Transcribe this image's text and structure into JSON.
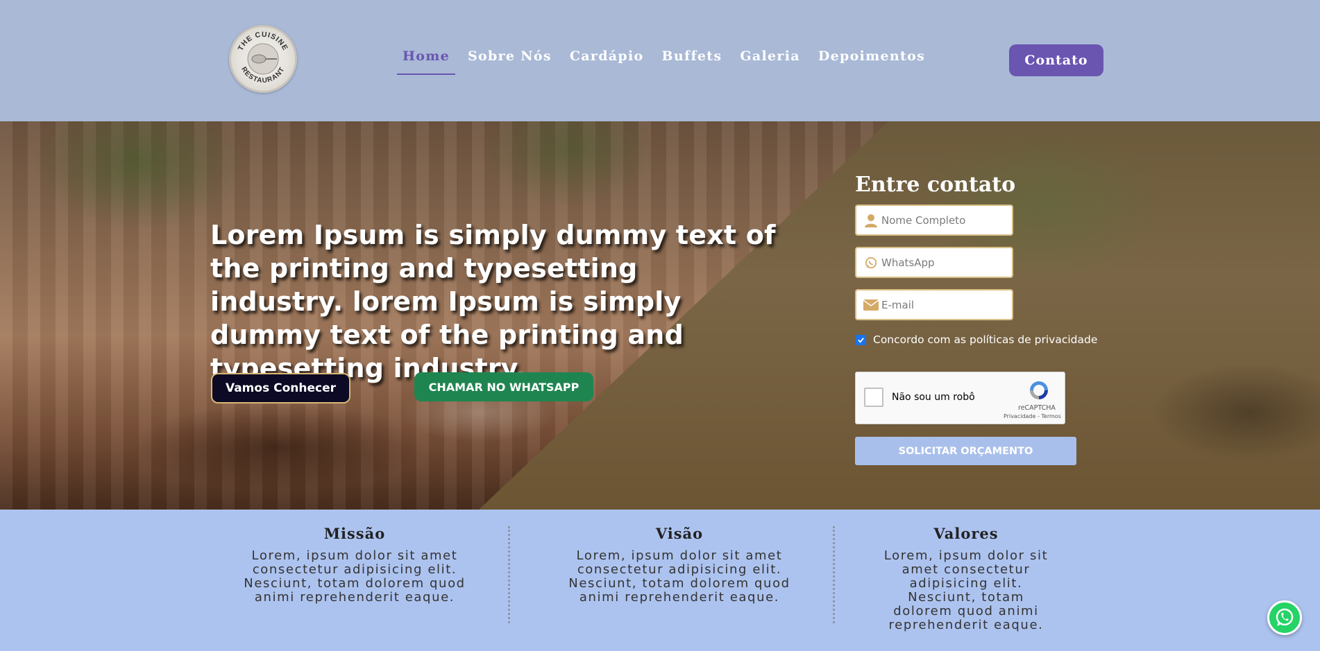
{
  "header": {
    "logo_alt": "THE CUISINE RESTAURANT",
    "nav": [
      {
        "label": "Home",
        "active": true
      },
      {
        "label": "Sobre Nós"
      },
      {
        "label": "Cardápio"
      },
      {
        "label": "Buffets"
      },
      {
        "label": "Galeria"
      },
      {
        "label": "Depoimentos"
      }
    ],
    "contact_label": "Contato"
  },
  "hero": {
    "title": "Lorem Ipsum is simply dummy text of the printing and typesetting industry. lorem Ipsum is simply dummy text of the printing and typesetting industry.",
    "primary_button": "Vamos Conhecer",
    "whatsapp_button": "CHAMAR NO WHATSAPP"
  },
  "form": {
    "title": "Entre contato",
    "name_placeholder": "Nome Completo",
    "whatsapp_placeholder": "WhatsApp",
    "email_placeholder": "E-mail",
    "consent_label": "Concordo com as políticas de privacidade",
    "consent_checked": true,
    "recaptcha_label": "Não sou um robô",
    "recaptcha_brand": "reCAPTCHA",
    "recaptcha_terms": "Privacidade - Termos",
    "submit_label": "SOLICITAR ORÇAMENTO"
  },
  "values": [
    {
      "title": "Missão",
      "text": "Lorem, ipsum dolor sit amet consectetur adipisicing elit. Nesciunt, totam dolorem quod animi reprehenderit eaque."
    },
    {
      "title": "Visão",
      "text": "Lorem, ipsum dolor sit amet consectetur adipisicing elit. Nesciunt, totam dolorem quod animi reprehenderit eaque."
    },
    {
      "title": "Valores",
      "text": "Lorem, ipsum dolor sit amet consectetur adipisicing elit. Nesciunt, totam dolorem quod animi reprehenderit eaque."
    }
  ],
  "icons": {
    "name": "user-icon",
    "whatsapp": "whatsapp-icon",
    "email": "envelope-icon",
    "floating": "whatsapp-icon"
  },
  "colors": {
    "accent": "#6a55b1",
    "whatsapp": "#1f8550",
    "header_bg": "#a9b9d6",
    "section_bg": "#adc3ef",
    "field_border": "#d9bf87"
  }
}
